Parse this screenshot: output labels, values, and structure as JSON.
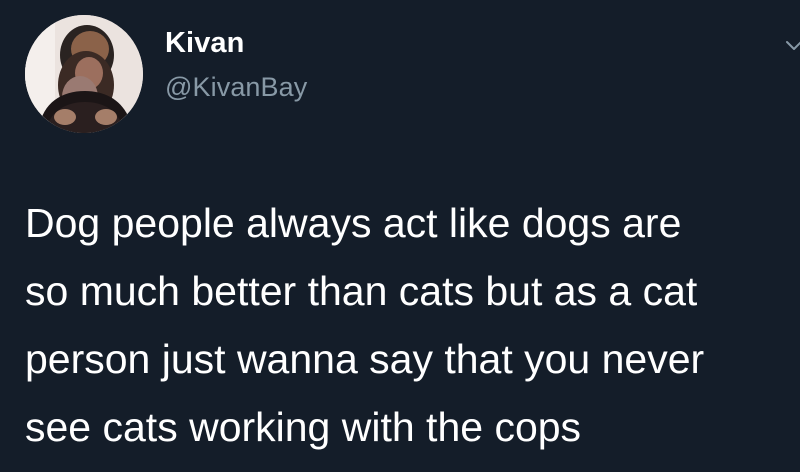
{
  "tweet": {
    "display_name": "Kivan",
    "handle": "@KivanBay",
    "text_lines": [
      "Dog people always act like dogs are",
      "so much better than cats but as a cat",
      "person just wanna say that you never",
      "see cats working with the cops"
    ]
  },
  "colors": {
    "background": "#141d29",
    "primary_text": "#ffffff",
    "secondary_text": "#8899a6"
  },
  "icons": {
    "avatar": "profile-photo",
    "more": "chevron-down-icon"
  }
}
